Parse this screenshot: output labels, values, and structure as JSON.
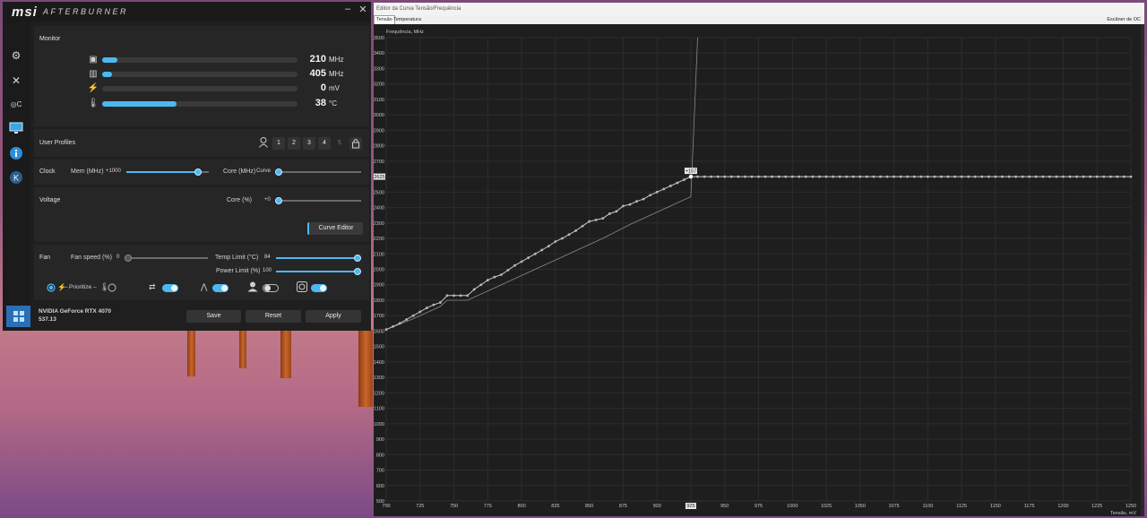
{
  "afterburner": {
    "logo": "msi",
    "subtitle": "AFTERBURNER",
    "window_controls": {
      "minimize": "–",
      "close": "✕"
    },
    "sidebar_icons": [
      "settings-icon",
      "monitoring-icon",
      "oc-scanner-icon",
      "display-icon",
      "info-icon",
      "k-boost-icon",
      "windows-tile-icon"
    ],
    "monitor": {
      "title": "Monitor",
      "rows": [
        {
          "icon": "gpu-chip-icon",
          "value": "210",
          "unit": "MHz",
          "fill_percent": 8
        },
        {
          "icon": "memory-icon",
          "value": "405",
          "unit": "MHz",
          "fill_percent": 5
        },
        {
          "icon": "voltage-icon",
          "value": "0",
          "unit": "mV",
          "fill_percent": 0
        },
        {
          "icon": "thermometer-icon",
          "value": "38",
          "unit": "°C",
          "fill_percent": 38
        }
      ]
    },
    "profiles": {
      "title": "User Profiles",
      "slots": [
        "1",
        "2",
        "3",
        "4",
        "5"
      ]
    },
    "clock": {
      "title": "Clock",
      "mem_label": "Mem (MHz)",
      "mem_value": "+1000",
      "mem_percent": 87,
      "core_label": "Core (MHz)",
      "core_value": "Curve",
      "core_percent": 0
    },
    "voltage": {
      "title": "Voltage",
      "core_label": "Core (%)",
      "core_value": "+0",
      "core_percent": 0,
      "curve_editor_button": "Curve Editor"
    },
    "fan": {
      "title": "Fan",
      "speed_label": "Fan speed (%)",
      "speed_value": "0",
      "speed_percent": 0,
      "temp_limit_label": "Temp Limit (°C)",
      "temp_limit_value": "84",
      "temp_limit_percent": 96,
      "power_limit_label": "Power Limit (%)",
      "power_limit_value": "100",
      "power_limit_percent": 96,
      "prioritize_label": "Prioritize",
      "toggles": [
        {
          "icon": "link-arrows-icon",
          "on": true
        },
        {
          "icon": "curve-icon",
          "on": true
        },
        {
          "icon": "user-icon",
          "on": false
        },
        {
          "icon": "fan-icon",
          "on": true
        }
      ]
    },
    "gpu": {
      "name": "NVIDIA GeForce RTX 4070",
      "driver": "537.13"
    },
    "buttons": {
      "save": "Save",
      "reset": "Reset",
      "apply": "Apply"
    }
  },
  "curve_editor": {
    "title": "Editor da Curva Tensão/Frequência",
    "tabs": [
      "Tensão",
      "Temperatura"
    ],
    "active_tab": "Tensão",
    "scanner": "Escâner de OC",
    "chart_data": {
      "type": "line",
      "xlabel": "Tensão, mV",
      "ylabel": "Frequência, MHz",
      "xlim": [
        700,
        1250
      ],
      "ylim": [
        500,
        3500
      ],
      "x_ticks": [
        "700",
        "725",
        "750",
        "775",
        "800",
        "825",
        "850",
        "875",
        "900",
        "925",
        "950",
        "975",
        "1000",
        "1025",
        "1050",
        "1075",
        "1100",
        "1125",
        "1150",
        "1175",
        "1200",
        "1225",
        "1250"
      ],
      "y_ticks": [
        "500",
        "600",
        "700",
        "800",
        "900",
        "1000",
        "1100",
        "1200",
        "1300",
        "1400",
        "1500",
        "1600",
        "1700",
        "1800",
        "1900",
        "2000",
        "2100",
        "2200",
        "2300",
        "2400",
        "2500",
        "2600",
        "2700",
        "2800",
        "2900",
        "3000",
        "3100",
        "3200",
        "3300",
        "3400",
        "3500"
      ],
      "grid": true,
      "selected_point": {
        "x": 925,
        "y": 2600,
        "offset_label": "+157",
        "x_label": "925",
        "y_label": "2625"
      },
      "series": [
        {
          "role": "edited",
          "x": [
            700,
            705,
            710,
            715,
            720,
            725,
            730,
            735,
            740,
            745,
            750,
            755,
            760,
            765,
            770,
            775,
            780,
            785,
            790,
            795,
            800,
            805,
            810,
            815,
            820,
            825,
            830,
            835,
            840,
            845,
            850,
            855,
            860,
            865,
            870,
            875,
            880,
            885,
            890,
            895,
            900,
            905,
            910,
            915,
            920,
            925,
            930,
            935,
            940,
            945,
            950,
            955,
            960,
            965,
            970,
            975,
            980,
            985,
            990,
            995,
            1000,
            1005,
            1010,
            1015,
            1020,
            1025,
            1030,
            1035,
            1040,
            1045,
            1050,
            1055,
            1060,
            1065,
            1070,
            1075,
            1080,
            1085,
            1090,
            1095,
            1100,
            1105,
            1110,
            1115,
            1120,
            1125,
            1130,
            1135,
            1140,
            1145,
            1150,
            1155,
            1160,
            1165,
            1170,
            1175,
            1180,
            1185,
            1190,
            1195,
            1200,
            1205,
            1210,
            1215,
            1220,
            1225,
            1230,
            1235,
            1240,
            1245,
            1250
          ],
          "y": [
            1610,
            1630,
            1650,
            1675,
            1700,
            1725,
            1750,
            1770,
            1785,
            1830,
            1830,
            1830,
            1830,
            1870,
            1900,
            1930,
            1950,
            1965,
            1995,
            2025,
            2050,
            2075,
            2100,
            2125,
            2150,
            2180,
            2200,
            2225,
            2250,
            2280,
            2310,
            2320,
            2330,
            2360,
            2375,
            2410,
            2420,
            2440,
            2455,
            2480,
            2500,
            2520,
            2540,
            2560,
            2580,
            2600,
            2600,
            2600,
            2600,
            2600,
            2600,
            2600,
            2600,
            2600,
            2600,
            2600,
            2600,
            2600,
            2600,
            2600,
            2600,
            2600,
            2600,
            2600,
            2600,
            2600,
            2600,
            2600,
            2600,
            2600,
            2600,
            2600,
            2600,
            2600,
            2600,
            2600,
            2600,
            2600,
            2600,
            2600,
            2600,
            2600,
            2600,
            2600,
            2600,
            2600,
            2600,
            2600,
            2600,
            2600,
            2600,
            2600,
            2600,
            2600,
            2600,
            2600,
            2600,
            2600,
            2600,
            2600,
            2600,
            2600,
            2600,
            2600,
            2600,
            2600,
            2600,
            2600,
            2600,
            2600,
            2600
          ]
        },
        {
          "role": "default",
          "x": [
            700,
            720,
            740,
            745,
            760,
            780,
            800,
            820,
            840,
            860,
            880,
            900,
            920,
            925,
            930
          ],
          "y": [
            1610,
            1680,
            1760,
            1800,
            1800,
            1880,
            1960,
            2040,
            2120,
            2200,
            2290,
            2370,
            2450,
            2470,
            3500
          ]
        }
      ]
    }
  }
}
